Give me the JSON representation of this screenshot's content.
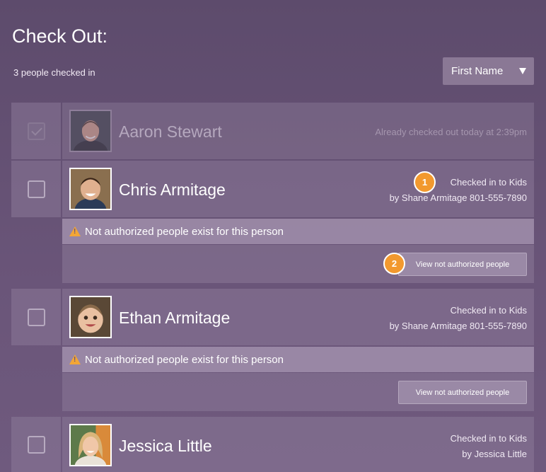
{
  "header": {
    "title": "Check Out:",
    "checked_in_count": "3 people checked in",
    "sort": {
      "selected": "First Name"
    }
  },
  "people": [
    {
      "name": "Aaron Stewart",
      "status_line1": "Already checked out today at 2:39pm",
      "checked_out": true
    },
    {
      "name": "Chris Armitage",
      "status_line1": "Checked in to Kids",
      "status_line2": "by Shane Armitage 801-555-7890",
      "warning": "Not authorized people exist for this person",
      "view_button": "View not authorized people"
    },
    {
      "name": "Ethan Armitage",
      "status_line1": "Checked in to Kids",
      "status_line2": "by Shane Armitage 801-555-7890",
      "warning": "Not authorized people exist for this person",
      "view_button": "View not authorized people"
    },
    {
      "name": "Jessica Little",
      "status_line1": "Checked in to Kids",
      "status_line2": "by Jessica Little"
    }
  ],
  "badges": [
    "1",
    "2"
  ],
  "colors": {
    "accent_badge": "#f2992e",
    "warning_icon": "#f3a635"
  }
}
